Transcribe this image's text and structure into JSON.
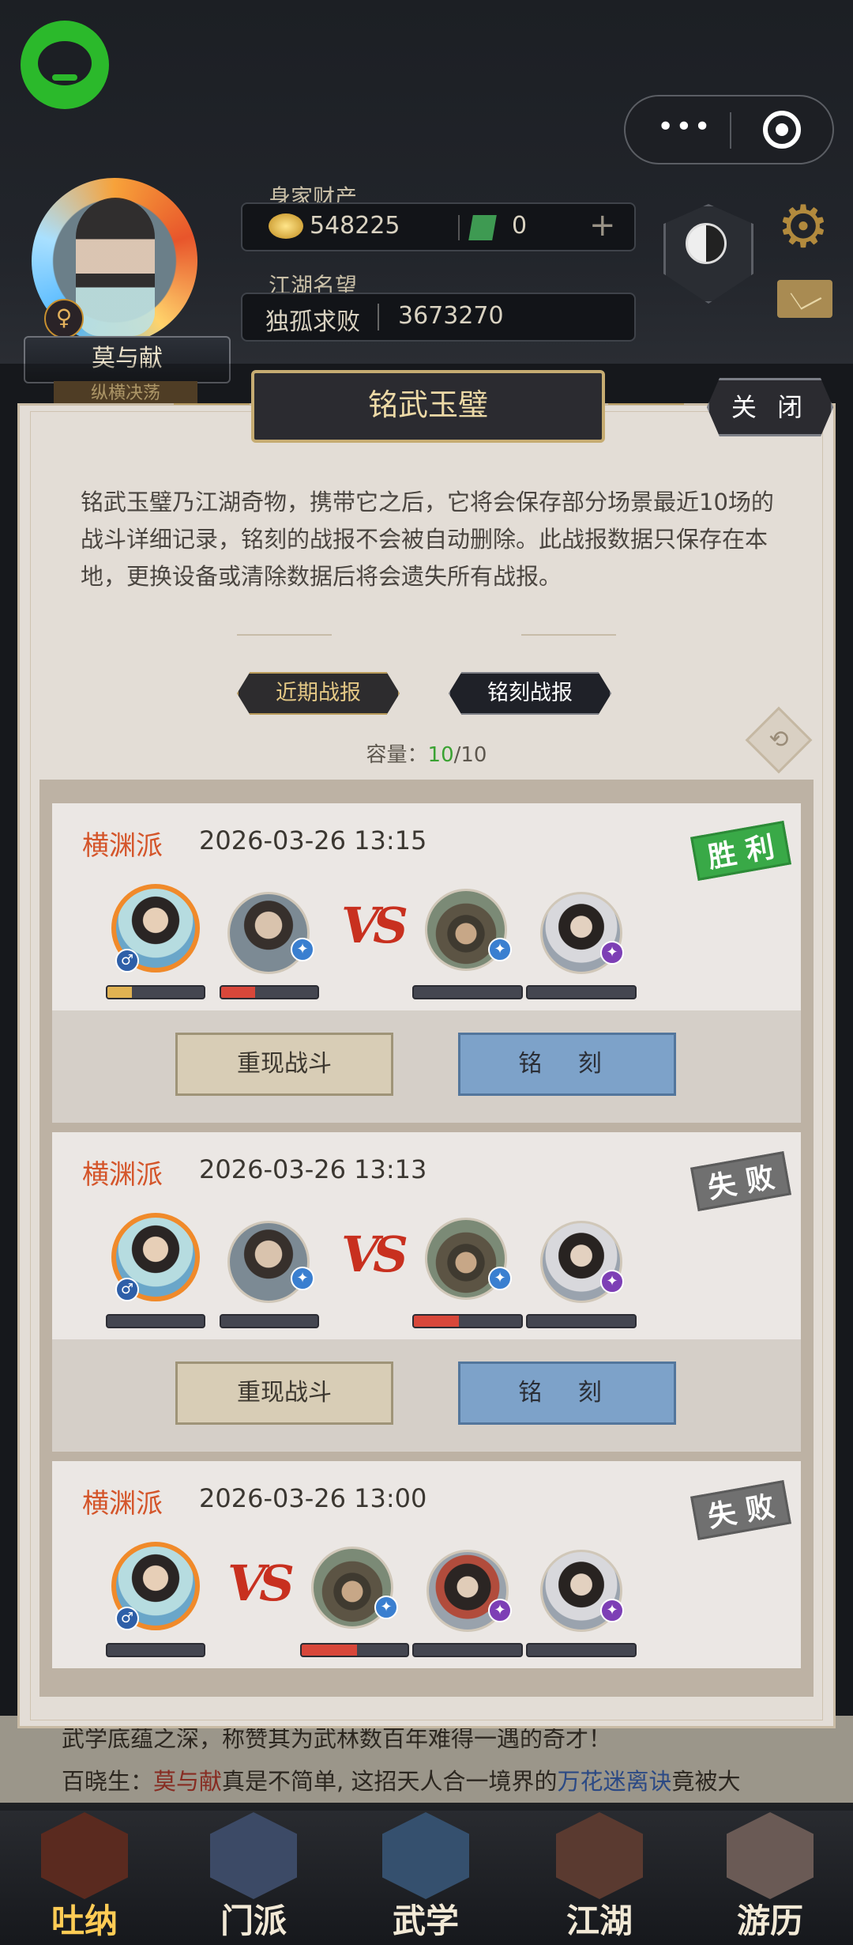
{
  "player": {
    "name": "莫与献",
    "title": "纵横决荡",
    "gender_icon": "♀",
    "wealth_label": "身家财产",
    "coins": "548225",
    "jade": "0",
    "plus": "+",
    "fame_label": "江湖名望",
    "fame_title": "独孤求败",
    "fame_value": "3673270",
    "side_badge": "-"
  },
  "capsule": {
    "more": "•••"
  },
  "modal": {
    "title": "铭武玉璧",
    "close_label": "关 闭",
    "description": "铭武玉璧乃江湖奇物，携带它之后，它将会保存部分场景最近10场的战斗详细记录，铭刻的战报不会被自动删除。此战报数据只保存在本地，更换设备或清除数据后将会遗失所有战报。",
    "tabs": [
      "近期战报",
      "铭刻战报"
    ],
    "capacity_label": "容量：",
    "capacity_used": "10",
    "capacity_total": "/10",
    "refresh_icon": "refresh-icon"
  },
  "battles": [
    {
      "sect": "横渊派",
      "time": "2026-03-26 13:15",
      "result": "胜 利",
      "replay_label": "重现战斗",
      "engrave_label": "铭 刻",
      "left_hp": [
        0.25,
        0.35
      ],
      "right_hp": [
        0,
        0
      ]
    },
    {
      "sect": "横渊派",
      "time": "2026-03-26 13:13",
      "result": "失 败",
      "replay_label": "重现战斗",
      "engrave_label": "铭 刻",
      "left_hp": [
        0,
        0
      ],
      "right_hp": [
        0.42,
        0
      ]
    },
    {
      "sect": "横渊派",
      "time": "2026-03-26 13:00",
      "result": "失 败",
      "left_hp": [
        0
      ],
      "right_hp": [
        0.52,
        0,
        0
      ]
    }
  ],
  "vs_text": "VS",
  "story": {
    "line1": "武学底蕴之深，称赞其为武林数百年难得一遇的奇才！",
    "line2_prefix": "百晓生：",
    "line2_name": "莫与献",
    "line2_mid": "真是不简单, 这招天人合一境界的",
    "line2_skill": "万花迷离诀",
    "line2_suffix": "竟被大"
  },
  "nav": [
    {
      "label": "吐纳",
      "active": true
    },
    {
      "label": "门派",
      "active": false
    },
    {
      "label": "武学",
      "active": false
    },
    {
      "label": "江湖",
      "active": false
    },
    {
      "label": "游历",
      "active": false
    }
  ],
  "background_fragment": "11,73"
}
